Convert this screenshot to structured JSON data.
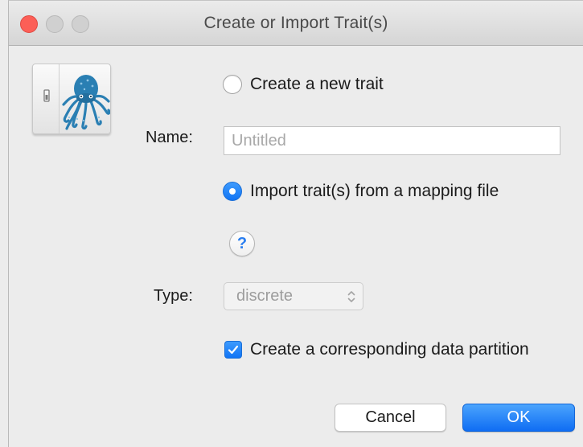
{
  "window": {
    "title": "Create or Import Trait(s)"
  },
  "app_icon": {
    "icon": "octopus-icon",
    "color": "#2a7fb3"
  },
  "options": {
    "create_new": {
      "label": "Create a new trait",
      "selected": false
    },
    "import_mapping": {
      "label": "Import trait(s) from a mapping file",
      "selected": true
    }
  },
  "name_field": {
    "label": "Name:",
    "value": "",
    "placeholder": "Untitled"
  },
  "help": {
    "glyph": "?"
  },
  "type_field": {
    "label": "Type:",
    "selected": "discrete",
    "enabled": false
  },
  "partition_checkbox": {
    "label": "Create a corresponding data partition",
    "checked": true
  },
  "buttons": {
    "cancel": "Cancel",
    "ok": "OK"
  },
  "colors": {
    "accent": "#1174f5",
    "close": "#fc5f57"
  }
}
